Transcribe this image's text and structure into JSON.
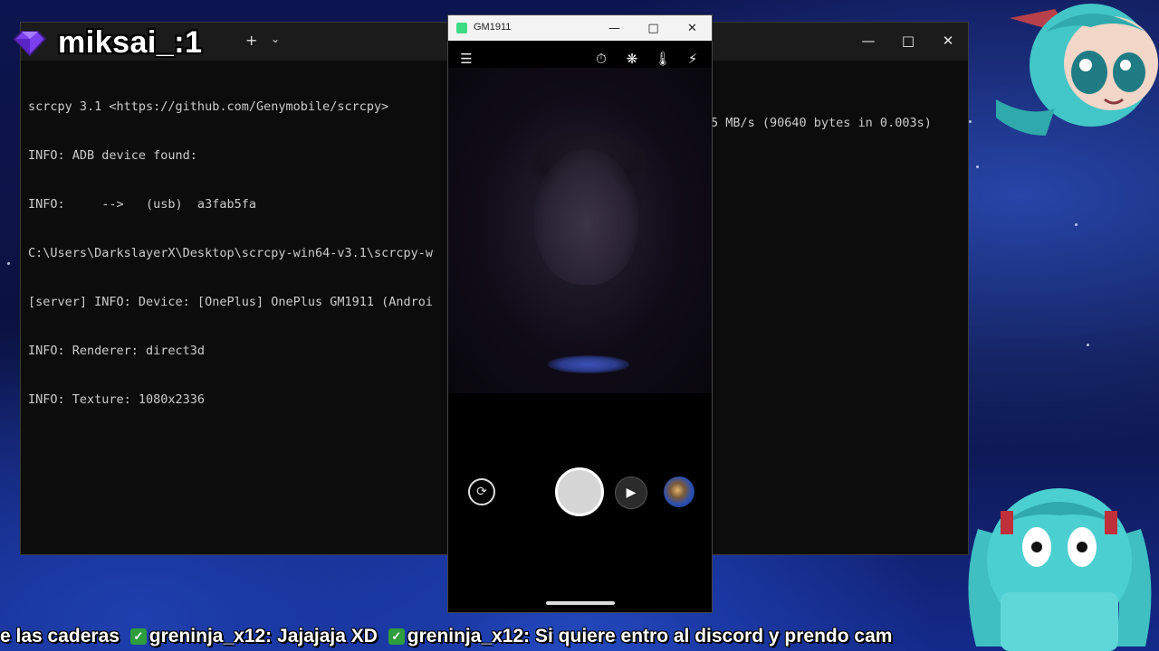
{
  "overlay": {
    "streamer_name": "miksai_:1"
  },
  "terminal": {
    "new_tab_icon": "+",
    "dropdown_icon": "⌄",
    "lines": [
      "scrcpy 3.1 <https://github.com/Genymobile/scrcpy>",
      "INFO: ADB device found:",
      "INFO:     -->   (usb)  a3fab5fa",
      "C:\\Users\\DarkslayerX\\Desktop\\scrcpy-win64-v3.1\\scrcpy-w",
      "[server] INFO: Device: [OnePlus] OnePlus GM1911 (Androi",
      "INFO: Renderer: direct3d",
      "INFO: Texture: 1080x2336"
    ],
    "line_tail": "5 MB/s (90640 bytes in 0.003s)"
  },
  "phone_window": {
    "title": "GM1911"
  },
  "camera": {
    "top_icons": [
      "menu-icon",
      "timer-off-icon",
      "motion-off-icon",
      "temperature-icon",
      "flash-off-icon"
    ],
    "shutter_row": [
      "rotate-camera-icon",
      "shutter-button",
      "video-icon",
      "gallery-thumbnail"
    ]
  },
  "ticker": {
    "segment_1": "e las caderas",
    "segment_2": "greninja_x12: Jajajaja XD",
    "segment_3": "greninja_x12: Si quiere entro al discord y prendo cam"
  },
  "colors": {
    "terminal_bg": "#0c0c0c",
    "terminal_text": "#cccccc",
    "check_green": "#2e9d3c",
    "miku_teal": "#43c6c8"
  }
}
